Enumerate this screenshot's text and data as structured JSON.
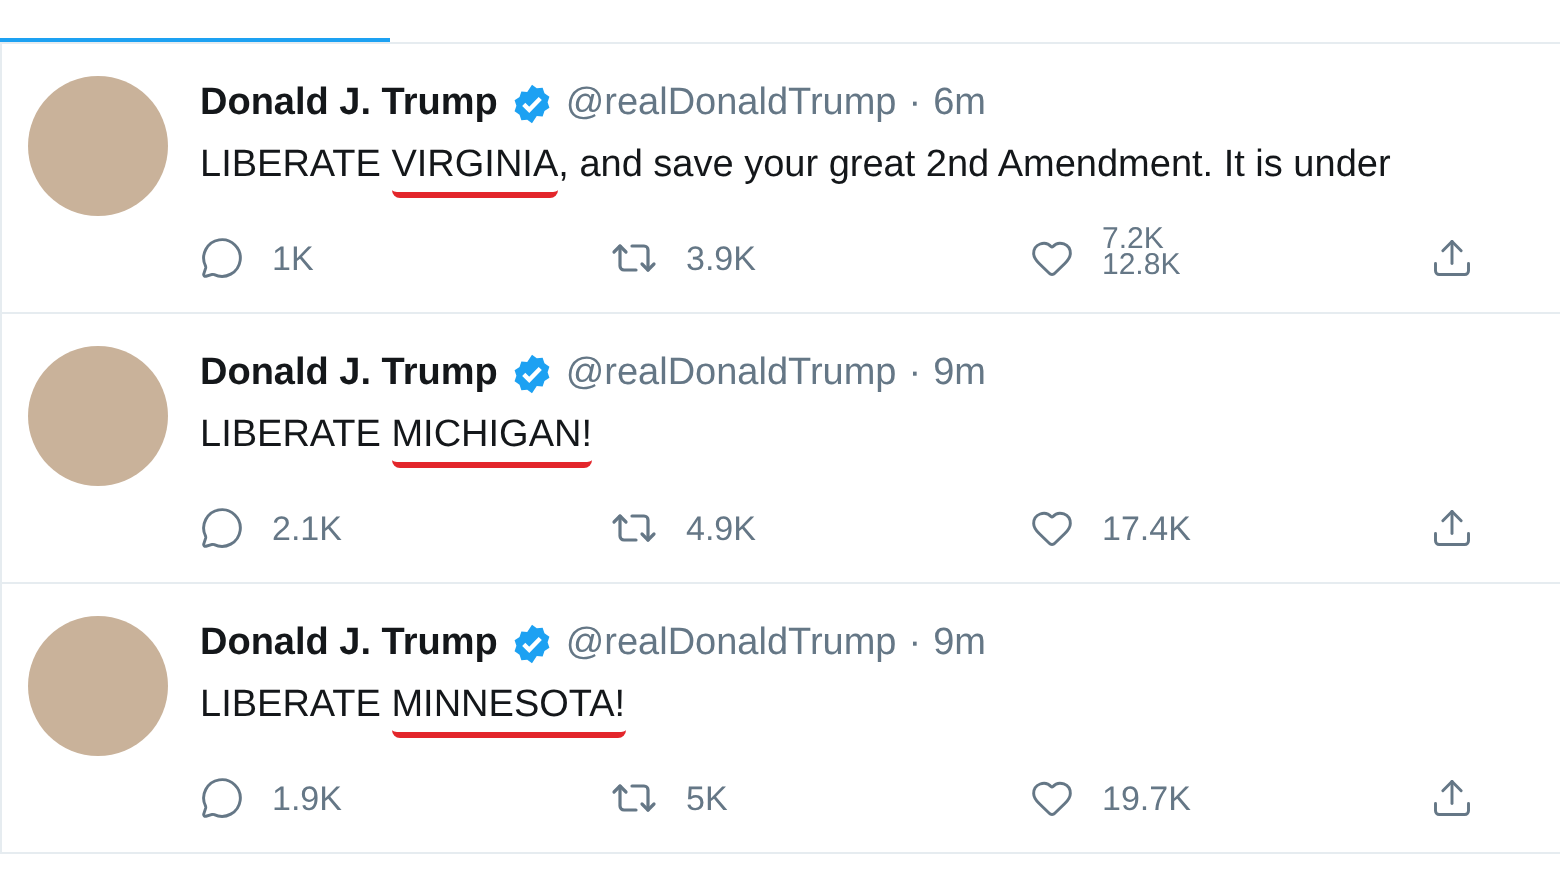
{
  "tweets": [
    {
      "name": "Donald J. Trump",
      "verified": true,
      "handle": "@realDonaldTrump",
      "separator": "·",
      "time": "6m",
      "text_parts": [
        {
          "text": "LIBERATE ",
          "marked": false
        },
        {
          "text": "VIRGINIA",
          "marked": true
        },
        {
          "text": ", and save your great 2nd Amendment. It is under",
          "marked": false
        }
      ],
      "replies": "1K",
      "retweets": "3.9K",
      "likes": [
        "7.2K",
        "12.8K"
      ]
    },
    {
      "name": "Donald J. Trump",
      "verified": true,
      "handle": "@realDonaldTrump",
      "separator": "·",
      "time": "9m",
      "text_parts": [
        {
          "text": "LIBERATE ",
          "marked": false
        },
        {
          "text": "MICHIGAN!",
          "marked": true
        }
      ],
      "replies": "2.1K",
      "retweets": "4.9K",
      "likes": [
        "17.4K"
      ]
    },
    {
      "name": "Donald J. Trump",
      "verified": true,
      "handle": "@realDonaldTrump",
      "separator": "·",
      "time": "9m",
      "text_parts": [
        {
          "text": "LIBERATE ",
          "marked": false
        },
        {
          "text": "MINNESOTA!",
          "marked": true
        }
      ],
      "replies": "1.9K",
      "retweets": "5K",
      "likes": [
        "19.7K"
      ]
    }
  ]
}
